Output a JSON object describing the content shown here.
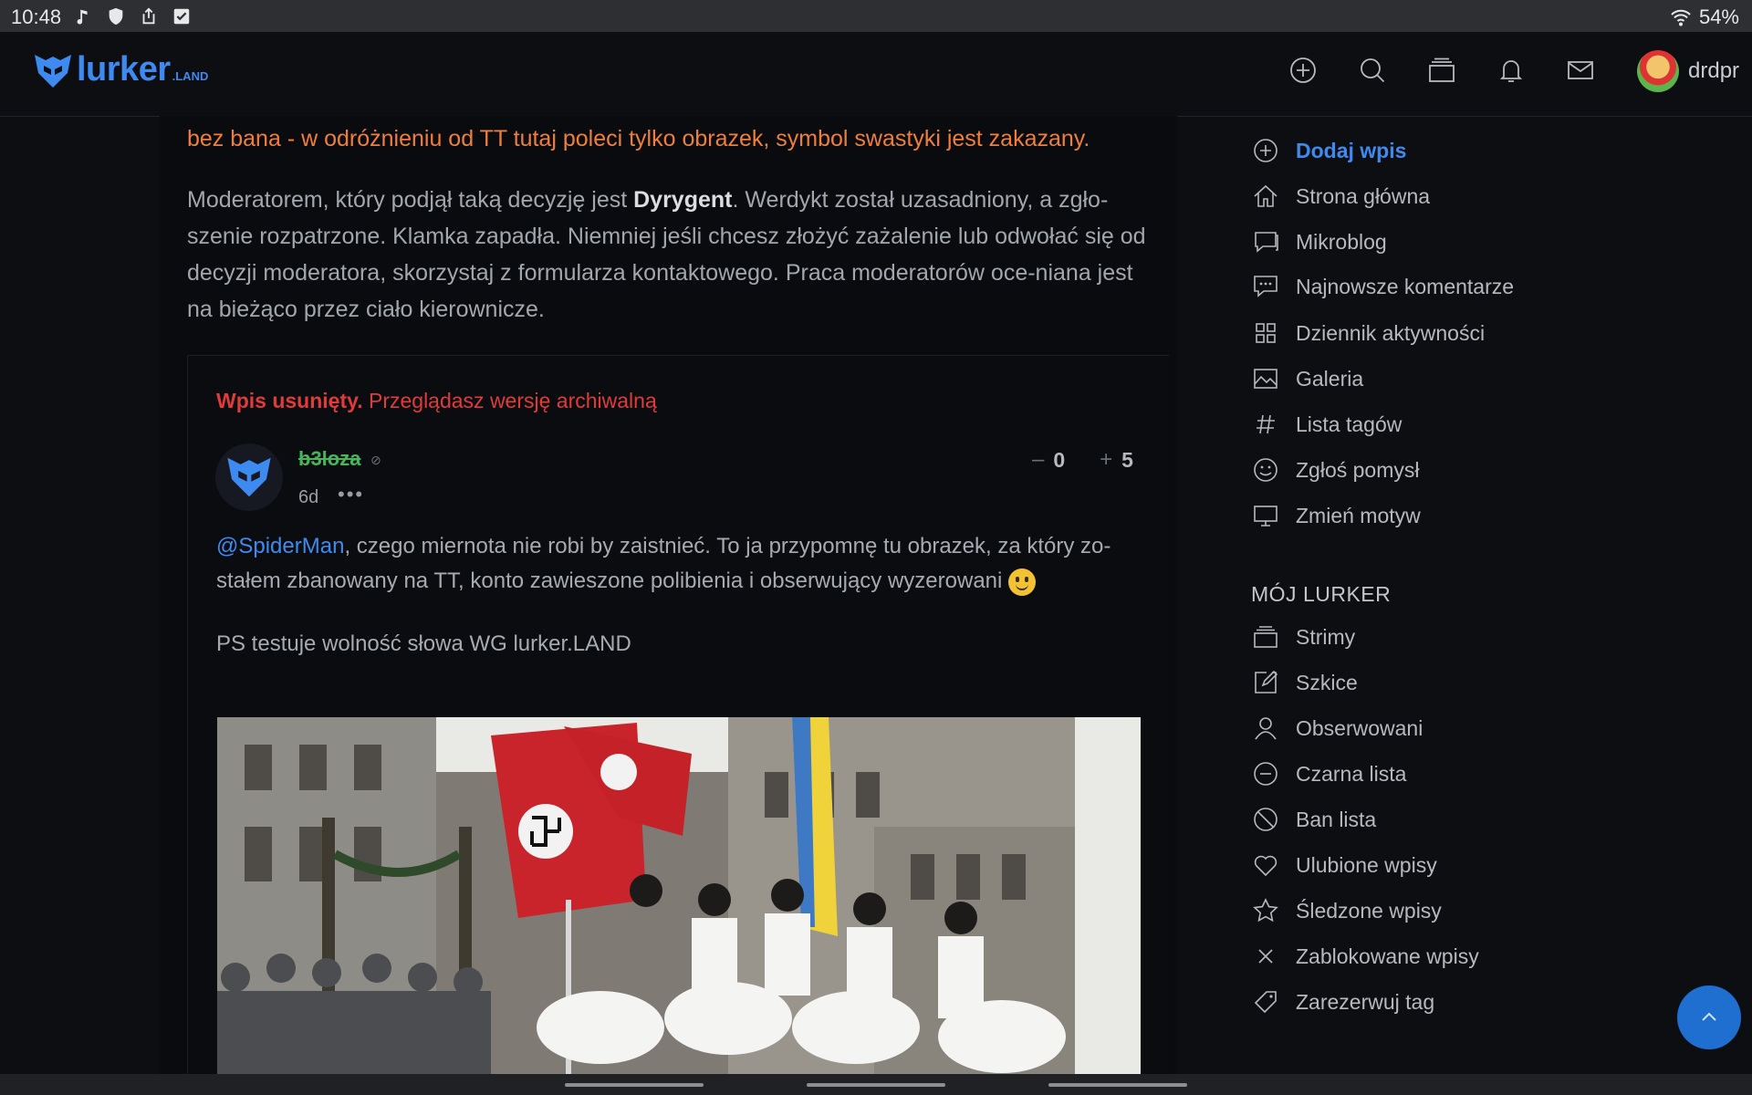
{
  "status_bar": {
    "time": "10:48",
    "battery": "54%"
  },
  "header": {
    "logo_text": "lurker",
    "logo_tld": ".LAND",
    "username": "drdpr"
  },
  "main": {
    "warning_text": "bez bana - w odróżnieniu od TT tutaj poleci tylko obrazek, symbol swastyki jest zakazany.",
    "moderation": {
      "before": "Moderatorem, który podjął taką decyzję jest ",
      "moderator": "Dyrygent",
      "after": ". Werdykt został uzasadniony, a zgło-szenie rozpatrzone. Klamka zapadła. Niemniej jeśli chcesz złożyć zażalenie lub odwołać się od decyzji moderatora, skorzystaj z formularza kontaktowego. Praca moderatorów oce-niana jest na bieżąco przez ciało kierownicze."
    },
    "post": {
      "deleted_label": "Wpis usunięty.",
      "archive_label": " Przeglądasz wersję archiwalną",
      "author": "b3loza",
      "age": "6d",
      "more": "•••",
      "minus_symbol": "–",
      "minus_count": "0",
      "plus_symbol": "+",
      "plus_count": "5",
      "mention": "@SpiderMan",
      "body": ", czego miernota nie robi by zaistnieć. To ja przypomnę tu obrazek, za który zo-stałem zbanowany na TT, konto zawieszone polibienia i obserwujący wyzerowani ",
      "ps": "PS testuje wolność słowa WG lurker.LAND"
    }
  },
  "sidebar": {
    "items": [
      {
        "label": "Dodaj wpis",
        "icon": "plus-circle-icon"
      },
      {
        "label": "Strona główna",
        "icon": "home-icon"
      },
      {
        "label": "Mikroblog",
        "icon": "chat-bubble-icon"
      },
      {
        "label": "Najnowsze komentarze",
        "icon": "comment-dots-icon"
      },
      {
        "label": "Dziennik aktywności",
        "icon": "grid-icon"
      },
      {
        "label": "Galeria",
        "icon": "image-icon"
      },
      {
        "label": "Lista tagów",
        "icon": "hash-icon"
      },
      {
        "label": "Zgłoś pomysł",
        "icon": "smile-icon"
      },
      {
        "label": "Zmień motyw",
        "icon": "monitor-icon"
      }
    ],
    "section_title": "MÓJ LURKER",
    "my_items": [
      {
        "label": "Strimy",
        "icon": "layers-icon"
      },
      {
        "label": "Szkice",
        "icon": "edit-icon"
      },
      {
        "label": "Obserwowani",
        "icon": "user-icon"
      },
      {
        "label": "Czarna lista",
        "icon": "minus-circle-icon"
      },
      {
        "label": "Ban lista",
        "icon": "ban-icon"
      },
      {
        "label": "Ulubione wpisy",
        "icon": "heart-icon"
      },
      {
        "label": "Śledzone wpisy",
        "icon": "star-icon"
      },
      {
        "label": "Zablokowane wpisy",
        "icon": "x-icon"
      },
      {
        "label": "Zarezerwuj tag",
        "icon": "tag-icon"
      }
    ]
  },
  "colors": {
    "accent": "#3d8bf0",
    "warning": "#f07e3a",
    "deleted": "#e03a3a",
    "author": "#47b65a",
    "background": "#0d0e12"
  }
}
